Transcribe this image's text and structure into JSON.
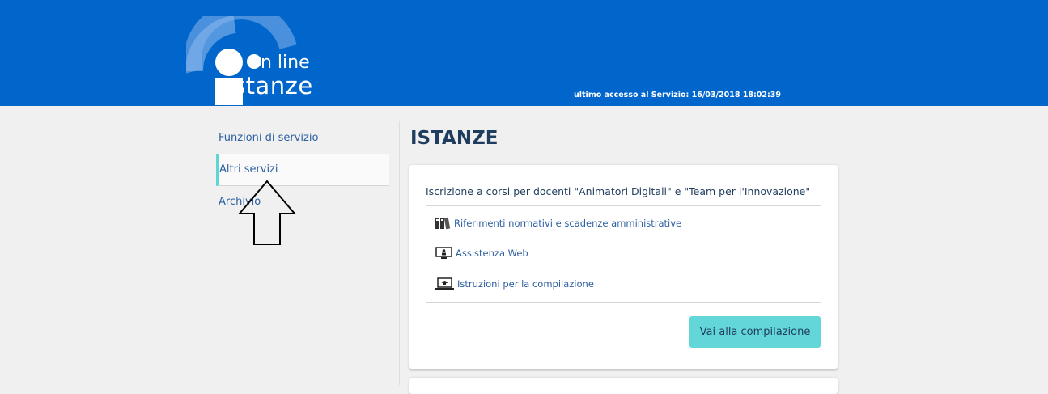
{
  "header": {
    "logo_line1": "n line",
    "logo_line2": "stanze",
    "last_access": "ultimo accesso al Servizio:  16/03/2018 18:02:39"
  },
  "sidebar": {
    "items": [
      {
        "label": "Funzioni di servizio"
      },
      {
        "label": "Altri servizi"
      },
      {
        "label": "Archivio"
      }
    ]
  },
  "main": {
    "title": "ISTANZE",
    "card": {
      "title": "Iscrizione a corsi per docenti \"Animatori Digitali\" e \"Team per l'Innovazione\"",
      "links": [
        {
          "label": "Riferimenti normativi e scadenze amministrative",
          "icon": "binders-icon"
        },
        {
          "label": "Assistenza Web",
          "icon": "monitor-user-icon"
        },
        {
          "label": "Istruzioni per la compilazione",
          "icon": "laptop-graduation-icon"
        }
      ],
      "button_label": "Vai alla compilazione"
    }
  },
  "colors": {
    "header_bg": "#0066cc",
    "accent": "#5fd6d4",
    "button_bg": "#62d6d8",
    "link": "#2d5fa0"
  }
}
